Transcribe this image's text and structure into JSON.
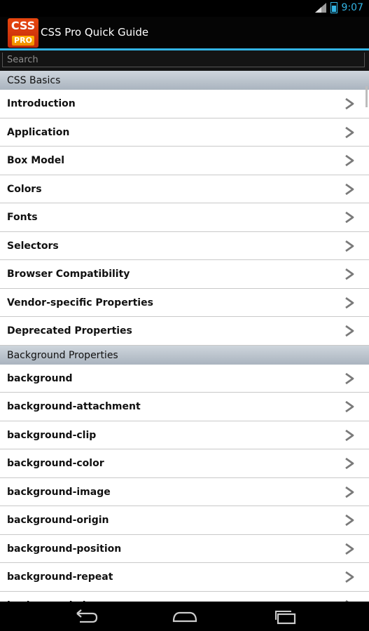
{
  "status": {
    "time": "9:07"
  },
  "app": {
    "title": "CSS Pro Quick Guide",
    "logo_top": "CSS",
    "logo_bottom": "PRO"
  },
  "search": {
    "placeholder": "Search"
  },
  "sections": [
    {
      "header": "CSS Basics",
      "items": [
        "Introduction",
        "Application",
        "Box Model",
        "Colors",
        "Fonts",
        "Selectors",
        "Browser Compatibility",
        "Vendor-specific Properties",
        "Deprecated Properties"
      ]
    },
    {
      "header": "Background Properties",
      "items": [
        "background",
        "background-attachment",
        "background-clip",
        "background-color",
        "background-image",
        "background-origin",
        "background-position",
        "background-repeat",
        "background-size"
      ]
    }
  ],
  "icons": {
    "row_icon": "chevron-right-icon",
    "nav": [
      "back-icon",
      "home-icon",
      "recent-apps-icon"
    ]
  },
  "colors": {
    "accent": "#33b5e5",
    "section_bg": "#bcc5cf"
  }
}
